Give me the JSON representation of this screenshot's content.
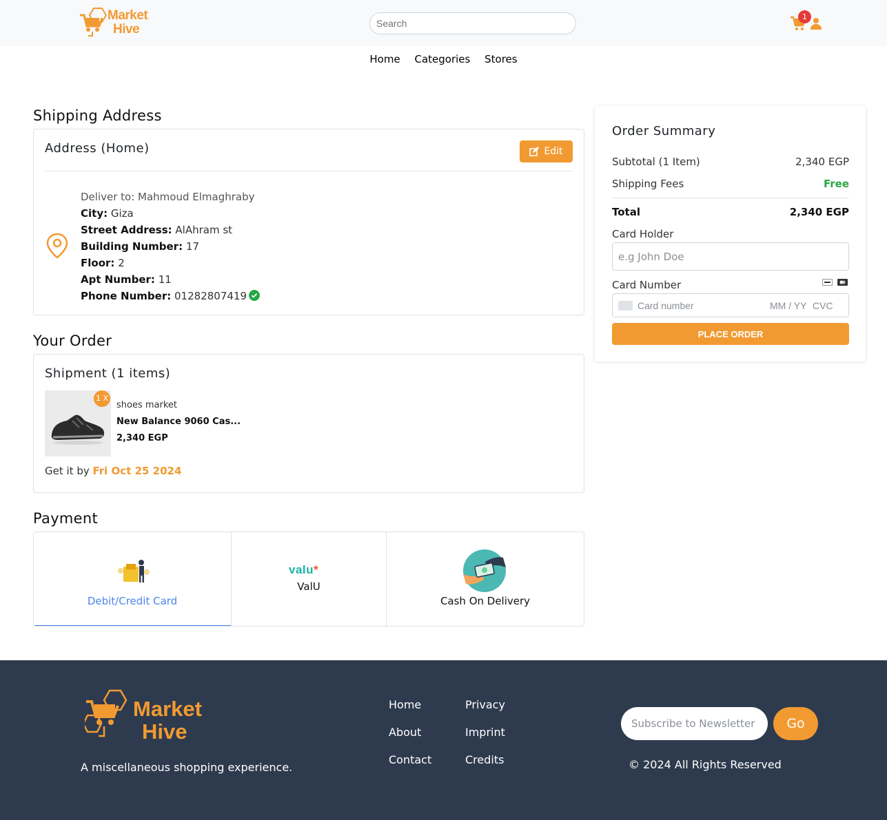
{
  "header": {
    "logo_line1": "Market",
    "logo_line2": "Hive",
    "search_placeholder": "Search",
    "cart_count": "1"
  },
  "nav": [
    "Home",
    "Categories",
    "Stores"
  ],
  "shipping": {
    "title": "Shipping Address",
    "card_title": "Address (Home)",
    "edit_label": "Edit",
    "deliver_to": "Deliver to: Mahmoud Elmaghraby",
    "city_label": "City:",
    "city": "Giza",
    "street_label": "Street Address:",
    "street": "AlAhram st",
    "building_label": "Building Number:",
    "building": "17",
    "floor_label": "Floor:",
    "floor": "2",
    "apt_label": "Apt Number:",
    "apt": "11",
    "phone_label": "Phone Number:",
    "phone": "01282807419"
  },
  "order": {
    "title": "Your Order",
    "shipment_title": "Shipment (1 items)",
    "qty_badge": "1 X",
    "store": "shoes market",
    "product": "New Balance 9060 Cas...",
    "price": "2,340 EGP",
    "get_it_by": "Get it by",
    "delivery_date": "Fri Oct 25 2024"
  },
  "payment": {
    "title": "Payment",
    "options": [
      {
        "label": "Debit/Credit Card",
        "active": true
      },
      {
        "label": "ValU",
        "logo_text": "valu",
        "active": false
      },
      {
        "label": "Cash On Delivery",
        "active": false
      }
    ]
  },
  "summary": {
    "title": "Order Summary",
    "subtotal_label": "Subtotal (1 Item)",
    "subtotal": "2,340 EGP",
    "shipping_label": "Shipping Fees",
    "shipping": "Free",
    "total_label": "Total",
    "total": "2,340 EGP",
    "holder_label": "Card Holder",
    "holder_placeholder": "e.g John Doe",
    "number_label": "Card Number",
    "number_placeholder": "Card number",
    "expiry_placeholder": "MM / YY",
    "cvc_placeholder": "CVC",
    "place_order": "PLACE ORDER"
  },
  "footer": {
    "logo_line1": "Market",
    "logo_line2": "Hive",
    "tagline": "A miscellaneous shopping experience.",
    "links_col1": [
      "Home",
      "About",
      "Contact"
    ],
    "links_col2": [
      "Privacy",
      "Imprint",
      "Credits"
    ],
    "newsletter_placeholder": "Subscribe to Newsletter",
    "go_label": "Go",
    "copyright": "© 2024 All Rights Reserved"
  },
  "colors": {
    "accent": "#f29a32",
    "footer_bg": "#2e3b4e",
    "success": "#28a745",
    "link_blue": "#4a86e8",
    "badge_red": "#e53935"
  }
}
